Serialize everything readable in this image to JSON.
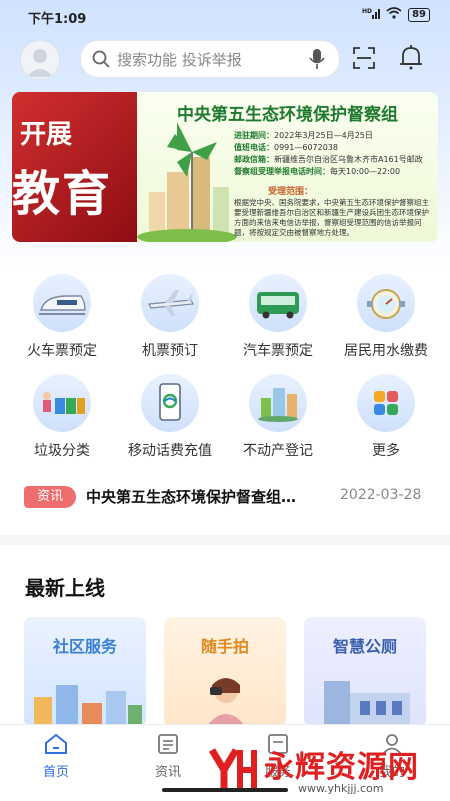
{
  "status_bar": {
    "time": "下午1:09",
    "signal": "HD",
    "battery": "89"
  },
  "header": {
    "search_placeholder": "搜索功能  投诉举报",
    "avatar_icon": "user-avatar-icon",
    "mic_icon": "microphone-icon",
    "scan_icon": "scan-icon",
    "bell_icon": "bell-icon"
  },
  "banner": {
    "left_line1": "开展",
    "left_line2": "教育",
    "title": "中央第五生态环境保护督察组",
    "rows": [
      {
        "label": "进驻期间：",
        "value": "2022年3月25日—4月25日"
      },
      {
        "label": "值班电话：",
        "value": "0991—6072038"
      },
      {
        "label": "邮政信箱：",
        "value": "新疆维吾尔自治区乌鲁木齐市A161号邮政"
      },
      {
        "label": "督察组受理举报电话时间：",
        "value": "每天10:00—22:00"
      }
    ],
    "range_label": "受理范围：",
    "range_text": "根据党中央、国务院要求，中央第五生态环境保护督察组主要受理新疆维吾尔自治区和新疆生产建设兵团生态环境保护方面的来信来电信访举报，督察组受理范围的信访举报问题，将按规定交由被督察地方处理。"
  },
  "services": [
    {
      "label": "火车票预定",
      "icon": "train-icon"
    },
    {
      "label": "机票预订",
      "icon": "airplane-icon"
    },
    {
      "label": "汽车票预定",
      "icon": "bus-icon"
    },
    {
      "label": "居民用水缴费",
      "icon": "water-meter-icon"
    },
    {
      "label": "垃圾分类",
      "icon": "garbage-sorting-icon"
    },
    {
      "label": "移动话费充值",
      "icon": "mobile-phone-icon"
    },
    {
      "label": "不动产登记",
      "icon": "buildings-icon"
    },
    {
      "label": "更多",
      "icon": "more-grid-icon"
    }
  ],
  "news": {
    "tag": "资讯",
    "title": "中央第五生态环境保护督查组…",
    "date": "2022-03-28"
  },
  "latest": {
    "title": "最新上线",
    "cards": [
      {
        "title": "社区服务",
        "color": "#3a7fd6"
      },
      {
        "title": "随手拍",
        "color": "#e08a1e"
      },
      {
        "title": "智慧公厕",
        "color": "#3a5fae"
      }
    ]
  },
  "tabs": [
    {
      "label": "首页",
      "active": true
    },
    {
      "label": "资讯",
      "active": false
    },
    {
      "label": "服务",
      "active": false
    },
    {
      "label": "我的",
      "active": false
    }
  ],
  "watermark": {
    "text": "永辉资源网",
    "url": "www.yhkjjj.com"
  },
  "colors": {
    "accent": "#2f6fe0",
    "tag": "#f06d6d",
    "banner_green": "#1f7a2f",
    "banner_red": "#c8252a"
  }
}
